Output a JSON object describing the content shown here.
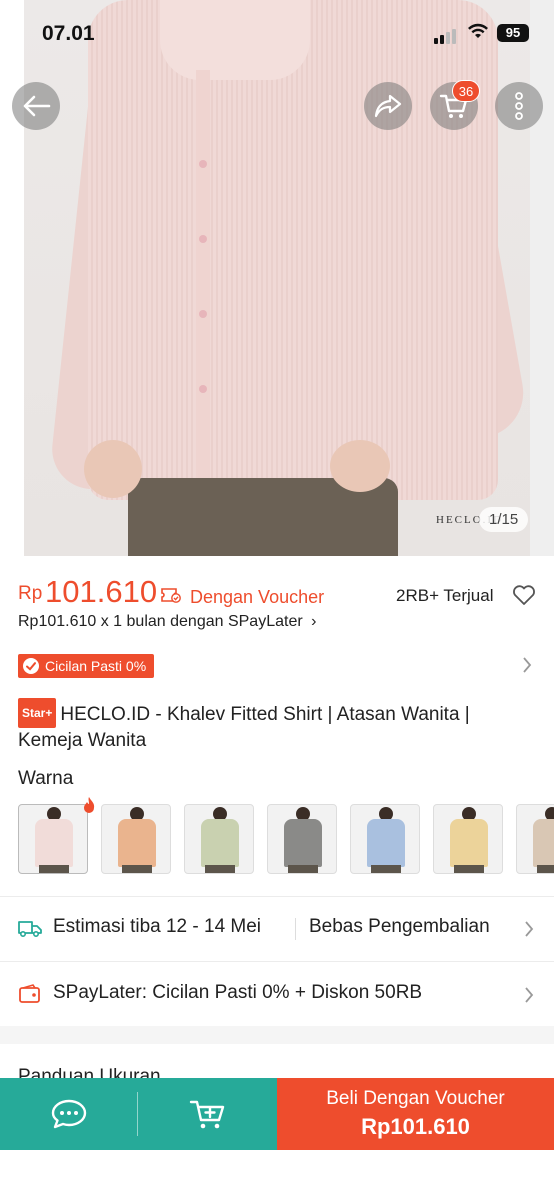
{
  "status_bar": {
    "time": "07.01",
    "battery": "95"
  },
  "hero": {
    "brand_watermark": "HECLO.ID",
    "image_counter": "1/15"
  },
  "header": {
    "cart_count": "36"
  },
  "price": {
    "currency": "Rp",
    "amount": "101.610",
    "voucher_label": "Dengan Voucher",
    "sold": "2RB+ Terjual"
  },
  "paylater_line": "Rp101.610 x 1 bulan dengan SPayLater",
  "cicilan_badge": "Cicilan Pasti 0%",
  "product": {
    "star_badge": "Star+",
    "title": "HECLO.ID - Khalev Fitted Shirt | Atasan Wanita | Kemeja Wanita"
  },
  "variants": {
    "label": "Warna",
    "swatch_colors": [
      "#f1dcd9",
      "#eab48e",
      "#c9d1b0",
      "#8a8a88",
      "#a9c0df",
      "#ecd39a",
      "#d9c7b4"
    ]
  },
  "shipping": {
    "estimate": "Estimasi tiba 12 - 14 Mei",
    "returns": "Bebas Pengembalian"
  },
  "promo_row": "SPayLater: Cicilan Pasti 0% + Diskon 50RB",
  "size_guide": "Panduan Ukuran",
  "bottom_bar": {
    "buy_label": "Beli Dengan Voucher",
    "buy_price": "Rp101.610"
  },
  "colors": {
    "accent": "#ee4d2d",
    "teal": "#26aa99"
  }
}
